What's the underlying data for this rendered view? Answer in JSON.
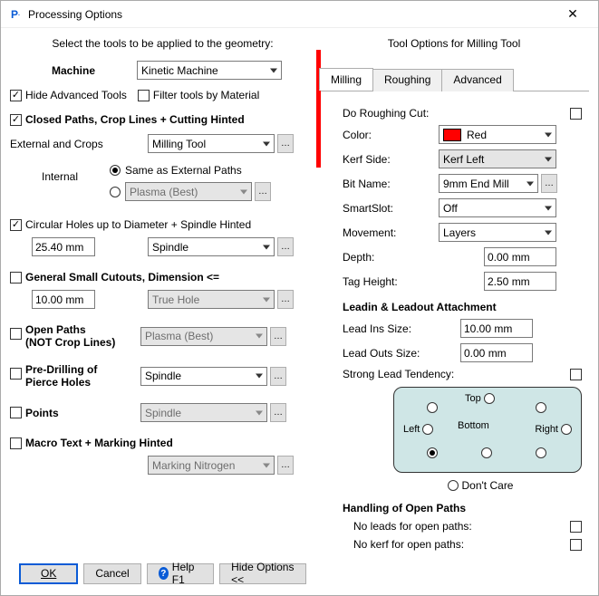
{
  "window": {
    "title": "Processing Options"
  },
  "left": {
    "header": "Select the tools to be applied to the geometry:",
    "machine_label": "Machine",
    "machine_value": "Kinetic Machine",
    "hide_adv": "Hide Advanced Tools",
    "filter_mat": "Filter tools by Material",
    "closed_paths": "Closed Paths,  Crop Lines  +  Cutting Hinted",
    "ext_crops": "External and Crops",
    "ext_tool": "Milling Tool",
    "internal_lbl": "Internal",
    "same_ext": "Same as External Paths",
    "plasma_best": "Plasma (Best)",
    "circ_holes": "Circular Holes up to Diameter   +  Spindle Hinted",
    "circ_val": "25.40 mm",
    "spindle": "Spindle",
    "gen_small": "General Small Cutouts, Dimension <=",
    "gen_val": "10.00 mm",
    "true_hole": "True Hole",
    "open_paths": "Open Paths",
    "open_paths2": "(NOT Crop Lines)",
    "pre_drill": "Pre-Drilling of",
    "pre_drill2": "Pierce Holes",
    "points": "Points",
    "macro": "Macro Text   +  Marking Hinted",
    "marking_nitro": "Marking Nitrogen"
  },
  "right": {
    "header": "Tool Options for Milling Tool",
    "tabs": {
      "milling": "Milling",
      "roughing": "Roughing",
      "advanced": "Advanced"
    },
    "do_rough": "Do Roughing Cut:",
    "color": "Color:",
    "color_val": "Red",
    "kerf_side": "Kerf Side:",
    "kerf_val": "Kerf Left",
    "bit_name": "Bit Name:",
    "bit_val": "9mm End Mill",
    "smartslot": "SmartSlot:",
    "smartslot_val": "Off",
    "movement": "Movement:",
    "movement_val": "Layers",
    "depth": "Depth:",
    "depth_val": "0.00 mm",
    "tag_h": "Tag Height:",
    "tag_h_val": "2.50 mm",
    "lead_head": "Leadin & Leadout Attachment",
    "lead_in": "Lead Ins Size:",
    "lead_in_val": "10.00 mm",
    "lead_out": "Lead Outs Size:",
    "lead_out_val": "0.00 mm",
    "strong_lead": "Strong Lead Tendency:",
    "top": "Top",
    "bottom": "Bottom",
    "left": "Left",
    "right_lbl": "Right",
    "dont_care": "Don't Care",
    "open_head": "Handling of Open Paths",
    "no_leads": "No leads for open paths:",
    "no_kerf": "No kerf for open paths:"
  },
  "footer": {
    "ok": "OK",
    "cancel": "Cancel",
    "help": "Help F1",
    "hide": "Hide Options <<"
  }
}
